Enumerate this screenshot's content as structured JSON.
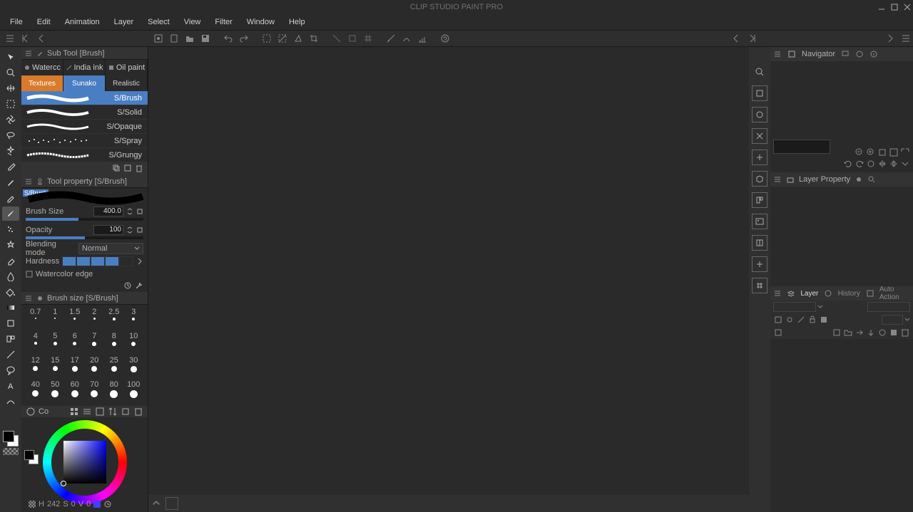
{
  "title": "CLIP STUDIO PAINT PRO",
  "menu": [
    "File",
    "Edit",
    "Animation",
    "Layer",
    "Select",
    "View",
    "Filter",
    "Window",
    "Help"
  ],
  "subtool": {
    "header": "Sub Tool [Brush]",
    "row1": [
      "Watercc",
      "India ink",
      "Oil paint"
    ],
    "row2": [
      "Textures",
      "Sunako",
      "Realistic"
    ],
    "brushes": [
      {
        "name": "S/Brush",
        "sel": true
      },
      {
        "name": "S/Solid"
      },
      {
        "name": "S/Opaque"
      },
      {
        "name": "S/Spray"
      },
      {
        "name": "S/Grungy"
      }
    ]
  },
  "tool_property": {
    "header": "Tool property [S/Brush]",
    "brush_name": "S/Brush",
    "brush_size_label": "Brush Size",
    "brush_size": "400.0",
    "opacity_label": "Opacity",
    "opacity": "100",
    "blending_label": "Blending mode",
    "blending_value": "Normal",
    "hardness_label": "Hardness",
    "watercolor_edge_label": "Watercolor edge"
  },
  "brush_size_panel": {
    "header": "Brush size [S/Brush]",
    "sizes": [
      "0.7",
      "1",
      "1.5",
      "2",
      "2.5",
      "3",
      "4",
      "5",
      "6",
      "7",
      "8",
      "10",
      "12",
      "15",
      "17",
      "20",
      "25",
      "30",
      "40",
      "50",
      "60",
      "70",
      "80",
      "100"
    ],
    "footer_label": "Co"
  },
  "color": {
    "h_label": "H",
    "h": "242",
    "s_label": "S",
    "s": "0",
    "v_label": "V",
    "v": "0"
  },
  "right": {
    "navigator": "Navigator",
    "layer_property": "Layer Property",
    "layer_tab": "Layer",
    "history_tab": "History",
    "auto_action_tab": "Auto Action"
  }
}
